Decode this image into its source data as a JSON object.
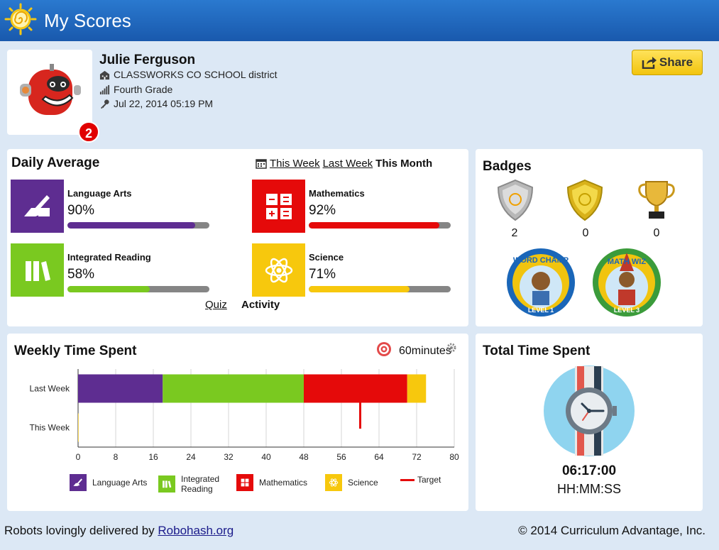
{
  "app": {
    "title": "My Scores"
  },
  "profile": {
    "name": "Julie Ferguson",
    "school": "CLASSWORKS CO SCHOOL district",
    "grade": "Fourth Grade",
    "last_login": "Jul 22, 2014 05:19 PM",
    "notification_count": "2"
  },
  "share": {
    "label": "Share"
  },
  "daily_average": {
    "title": "Daily Average",
    "periods": [
      "This Week",
      "Last Week",
      "This Month"
    ],
    "selected_period": "This Month",
    "subjects": [
      {
        "name": "Language Arts",
        "percent_label": "90%",
        "percent": 90,
        "color": "#5e2d91"
      },
      {
        "name": "Mathematics",
        "percent_label": "92%",
        "percent": 92,
        "color": "#e50a0a"
      },
      {
        "name": "Integrated Reading",
        "percent_label": "58%",
        "percent": 58,
        "color": "#7ac920"
      },
      {
        "name": "Science",
        "percent_label": "71%",
        "percent": 71,
        "color": "#f7c80d"
      }
    ],
    "tabs": {
      "quiz": "Quiz",
      "activity": "Activity"
    }
  },
  "badges": {
    "title": "Badges",
    "counts": [
      "2",
      "0",
      "0"
    ],
    "items": [
      "silver-shield",
      "gold-shield",
      "trophy"
    ],
    "awards": [
      {
        "text": "WORD CHAMP",
        "level": "LEVEL 1"
      },
      {
        "text": "MATH WIZ",
        "level": "LEVEL 3"
      }
    ]
  },
  "weekly": {
    "title": "Weekly Time Spent",
    "target_label": "60",
    "target_unit": "minutes"
  },
  "chart_data": {
    "type": "bar",
    "orientation": "horizontal",
    "stacked": true,
    "categories": [
      "Last Week",
      "This Week"
    ],
    "series": [
      {
        "name": "Language Arts",
        "color": "#5e2d91",
        "values": [
          18,
          0
        ]
      },
      {
        "name": "Integrated Reading",
        "color": "#7ac920",
        "values": [
          30,
          0
        ]
      },
      {
        "name": "Mathematics",
        "color": "#e50a0a",
        "values": [
          22,
          0
        ]
      },
      {
        "name": "Science",
        "color": "#f7c80d",
        "values": [
          4,
          0.1
        ]
      }
    ],
    "target": {
      "name": "Target",
      "value": 60,
      "color": "#e50a0a"
    },
    "xlim": [
      0,
      80
    ],
    "xticks": [
      "0",
      "8",
      "16",
      "24",
      "32",
      "40",
      "48",
      "56",
      "64",
      "72",
      "80"
    ],
    "grid": true,
    "legend_position": "bottom",
    "legend": [
      "Language Arts",
      "Integrated Reading",
      "Mathematics",
      "Science",
      "Target"
    ]
  },
  "total_time": {
    "title": "Total Time Spent",
    "value": "06:17:00",
    "format": "HH:MM:SS"
  },
  "footer": {
    "prefix": "Robots lovingly delivered by",
    "link": "Robohash.org",
    "copyright": "© 2014 Curriculum Advantage, Inc."
  }
}
